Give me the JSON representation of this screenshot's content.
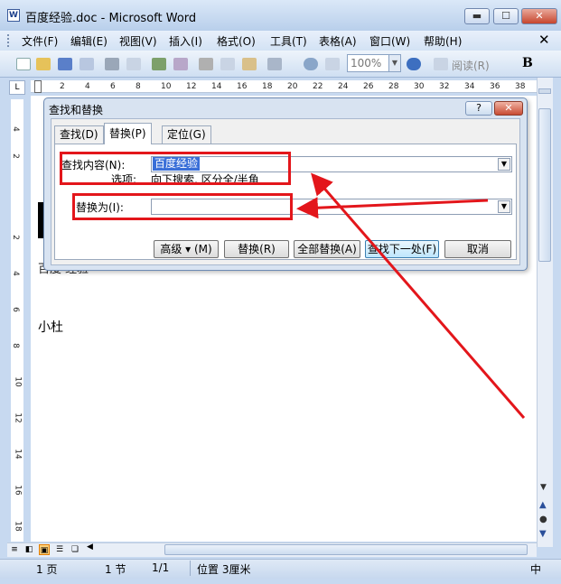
{
  "window": {
    "title": "百度经验.doc - Microsoft Word",
    "app_icon": "W",
    "minimize": "▬",
    "maximize": "☐",
    "close": "✕"
  },
  "menu": {
    "items": [
      "文件(F)",
      "编辑(E)",
      "视图(V)",
      "插入(I)",
      "格式(O)",
      "工具(T)",
      "表格(A)",
      "窗口(W)",
      "帮助(H)"
    ],
    "close_doc": "✕"
  },
  "toolbar": {
    "zoom": "100%",
    "reading": "阅读(R)",
    "bold": "B"
  },
  "ruler": {
    "corner": "L",
    "top_ticks": [
      "2",
      "4",
      "6",
      "8",
      "10",
      "12",
      "14",
      "16",
      "18",
      "20",
      "22",
      "24",
      "26",
      "28",
      "30",
      "32",
      "34",
      "36",
      "38"
    ],
    "left_ticks": [
      "4",
      "2",
      "2",
      "4",
      "6",
      "8",
      "10",
      "12",
      "14",
      "16",
      "18"
    ]
  },
  "document": {
    "partial_line": "百度   经验",
    "text": "小杜"
  },
  "dialog": {
    "title": "查找和替换",
    "help": "?",
    "close": "✕",
    "tabs": [
      "查找(D)",
      "替换(P)",
      "定位(G)"
    ],
    "find_label": "查找内容(N):",
    "find_value": "百度经验",
    "options_label": "选项:",
    "options_value": "向下搜索, 区分全/半角",
    "replace_label": "替换为(I):",
    "replace_value": "",
    "buttons": {
      "more": "高级 ▾ (M)",
      "replace": "替换(R)",
      "replace_all": "全部替换(A)",
      "find_next": "查找下一处(F)",
      "cancel": "取消"
    }
  },
  "status": {
    "page": "1 页",
    "section": "1 节",
    "page_of": "1/1",
    "position": "位置 3厘米",
    "lang": "中"
  },
  "annotation_color": "#e3161b"
}
